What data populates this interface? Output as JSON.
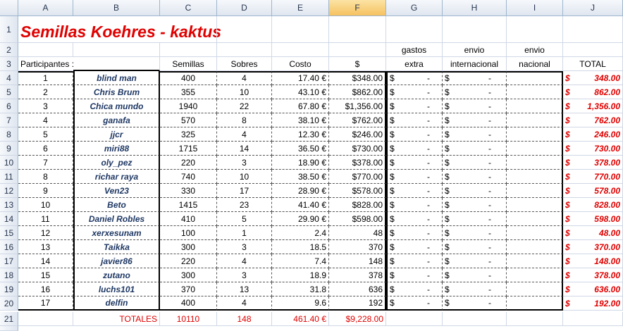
{
  "column_headers": [
    "A",
    "B",
    "C",
    "D",
    "E",
    "F",
    "G",
    "H",
    "I",
    "J"
  ],
  "title": "Semillas Koehres - kaktus",
  "labels": {
    "participantes": "Participantes :",
    "semillas": "Semillas",
    "sobres": "Sobres",
    "costo": "Costo",
    "dollar": "$",
    "gastos_top": "gastos",
    "gastos_bottom": "extra",
    "envio_int_top": "envio",
    "envio_int_bottom": "internacional",
    "envio_nac_top": "envio",
    "envio_nac_bottom": "nacional",
    "total": "TOTAL"
  },
  "currency_symbol": "$",
  "dash": "-",
  "rows": [
    {
      "rn": "4",
      "num": "1",
      "name": "blind man",
      "semillas": "400",
      "sobres": "4",
      "costo": "17.40 €",
      "usd": "$348.00",
      "total": "348.00"
    },
    {
      "rn": "5",
      "num": "2",
      "name": "Chris Brum",
      "semillas": "355",
      "sobres": "10",
      "costo": "43.10 €",
      "usd": "$862.00",
      "total": "862.00"
    },
    {
      "rn": "6",
      "num": "3",
      "name": "Chica mundo",
      "semillas": "1940",
      "sobres": "22",
      "costo": "67.80 €",
      "usd": "$1,356.00",
      "total": "1,356.00"
    },
    {
      "rn": "7",
      "num": "4",
      "name": "ganafa",
      "semillas": "570",
      "sobres": "8",
      "costo": "38.10 €",
      "usd": "$762.00",
      "total": "762.00"
    },
    {
      "rn": "8",
      "num": "5",
      "name": "jjcr",
      "semillas": "325",
      "sobres": "4",
      "costo": "12.30 €",
      "usd": "$246.00",
      "total": "246.00"
    },
    {
      "rn": "9",
      "num": "6",
      "name": "miri88",
      "semillas": "1715",
      "sobres": "14",
      "costo": "36.50 €",
      "usd": "$730.00",
      "total": "730.00"
    },
    {
      "rn": "10",
      "num": "7",
      "name": "oly_pez",
      "semillas": "220",
      "sobres": "3",
      "costo": "18.90 €",
      "usd": "$378.00",
      "total": "378.00"
    },
    {
      "rn": "11",
      "num": "8",
      "name": "richar raya",
      "semillas": "740",
      "sobres": "10",
      "costo": "38.50 €",
      "usd": "$770.00",
      "total": "770.00"
    },
    {
      "rn": "12",
      "num": "9",
      "name": "Ven23",
      "semillas": "330",
      "sobres": "17",
      "costo": "28.90 €",
      "usd": "$578.00",
      "total": "578.00"
    },
    {
      "rn": "13",
      "num": "10",
      "name": "Beto",
      "semillas": "1415",
      "sobres": "23",
      "costo": "41.40 €",
      "usd": "$828.00",
      "total": "828.00"
    },
    {
      "rn": "14",
      "num": "11",
      "name": "Daniel Robles",
      "semillas": "410",
      "sobres": "5",
      "costo": "29.90 €",
      "usd": "$598.00",
      "total": "598.00"
    },
    {
      "rn": "15",
      "num": "12",
      "name": "xerxesunam",
      "semillas": "100",
      "sobres": "1",
      "costo": "2.4",
      "usd": "48",
      "total": "48.00"
    },
    {
      "rn": "16",
      "num": "13",
      "name": "Taikka",
      "semillas": "300",
      "sobres": "3",
      "costo": "18.5",
      "usd": "370",
      "total": "370.00"
    },
    {
      "rn": "17",
      "num": "14",
      "name": "javier86",
      "semillas": "220",
      "sobres": "4",
      "costo": "7.4",
      "usd": "148",
      "total": "148.00"
    },
    {
      "rn": "18",
      "num": "15",
      "name": "zutano",
      "semillas": "300",
      "sobres": "3",
      "costo": "18.9",
      "usd": "378",
      "total": "378.00"
    },
    {
      "rn": "19",
      "num": "16",
      "name": "luchs101",
      "semillas": "370",
      "sobres": "13",
      "costo": "31.8",
      "usd": "636",
      "total": "636.00"
    },
    {
      "rn": "20",
      "num": "17",
      "name": "delfin",
      "semillas": "400",
      "sobres": "4",
      "costo": "9.6",
      "usd": "192",
      "total": "192.00"
    }
  ],
  "totals": {
    "rn": "21",
    "label": "TOTALES",
    "semillas": "10110",
    "sobres": "148",
    "costo": "461.40 €",
    "usd": "$9,228.00"
  },
  "colors": {
    "title": "#e00000",
    "names": "#1f3864",
    "selected_header": "#f6c260"
  }
}
